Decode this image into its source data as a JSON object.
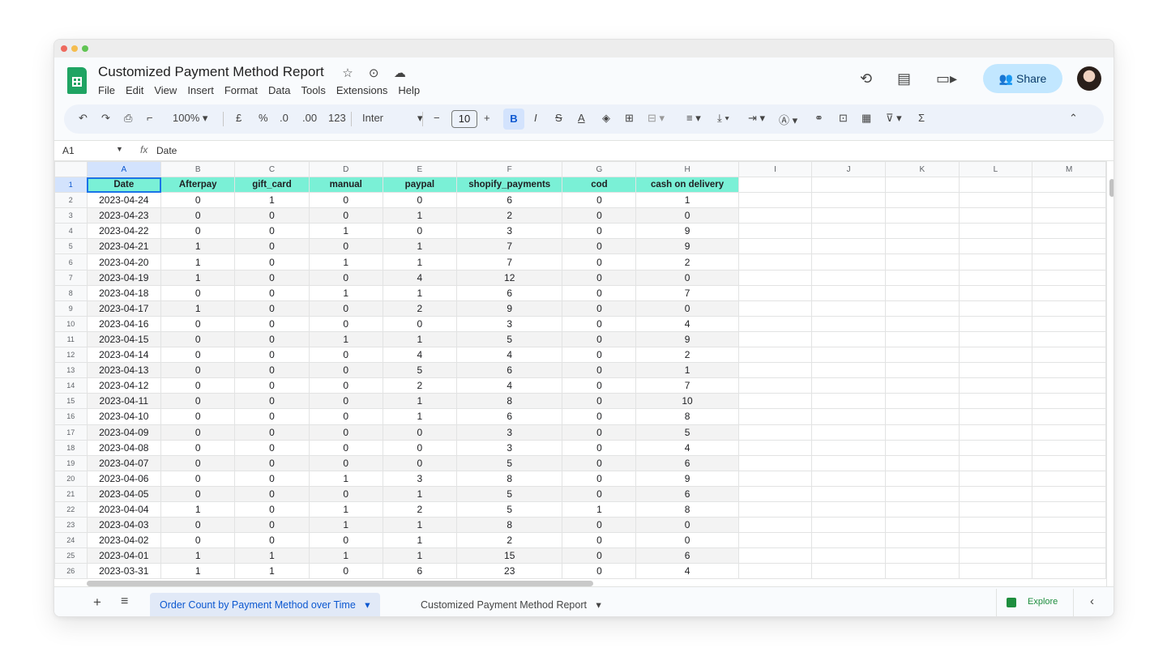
{
  "app": {
    "doc_title": "Customized Payment Method Report",
    "menu": [
      "File",
      "Edit",
      "View",
      "Insert",
      "Format",
      "Data",
      "Tools",
      "Extensions",
      "Help"
    ],
    "share_label": "Share"
  },
  "toolbar": {
    "zoom": "100%",
    "currency": "£",
    "percent": "%",
    "dec_decrease": ".0",
    "dec_increase": ".00",
    "number_format": "123",
    "font": "Inter",
    "font_size": "10",
    "bold": "B",
    "italic": "I",
    "strike": "S",
    "text_color": "A",
    "sum": "Σ"
  },
  "formula_bar": {
    "cell_ref": "A1",
    "fx": "fx",
    "value": "Date"
  },
  "columns": [
    "A",
    "B",
    "C",
    "D",
    "E",
    "F",
    "G",
    "H",
    "I",
    "J",
    "K",
    "L",
    "M"
  ],
  "headers": [
    "Date",
    "Afterpay",
    "gift_card",
    "manual",
    "paypal",
    "shopify_payments",
    "cod",
    "cash on delivery"
  ],
  "rows": [
    [
      "2023-04-24",
      "0",
      "1",
      "0",
      "0",
      "6",
      "0",
      "1"
    ],
    [
      "2023-04-23",
      "0",
      "0",
      "0",
      "1",
      "2",
      "0",
      "0"
    ],
    [
      "2023-04-22",
      "0",
      "0",
      "1",
      "0",
      "3",
      "0",
      "9"
    ],
    [
      "2023-04-21",
      "1",
      "0",
      "0",
      "1",
      "7",
      "0",
      "9"
    ],
    [
      "2023-04-20",
      "1",
      "0",
      "1",
      "1",
      "7",
      "0",
      "2"
    ],
    [
      "2023-04-19",
      "1",
      "0",
      "0",
      "4",
      "12",
      "0",
      "0"
    ],
    [
      "2023-04-18",
      "0",
      "0",
      "1",
      "1",
      "6",
      "0",
      "7"
    ],
    [
      "2023-04-17",
      "1",
      "0",
      "0",
      "2",
      "9",
      "0",
      "0"
    ],
    [
      "2023-04-16",
      "0",
      "0",
      "0",
      "0",
      "3",
      "0",
      "4"
    ],
    [
      "2023-04-15",
      "0",
      "0",
      "1",
      "1",
      "5",
      "0",
      "9"
    ],
    [
      "2023-04-14",
      "0",
      "0",
      "0",
      "4",
      "4",
      "0",
      "2"
    ],
    [
      "2023-04-13",
      "0",
      "0",
      "0",
      "5",
      "6",
      "0",
      "1"
    ],
    [
      "2023-04-12",
      "0",
      "0",
      "0",
      "2",
      "4",
      "0",
      "7"
    ],
    [
      "2023-04-11",
      "0",
      "0",
      "0",
      "1",
      "8",
      "0",
      "10"
    ],
    [
      "2023-04-10",
      "0",
      "0",
      "0",
      "1",
      "6",
      "0",
      "8"
    ],
    [
      "2023-04-09",
      "0",
      "0",
      "0",
      "0",
      "3",
      "0",
      "5"
    ],
    [
      "2023-04-08",
      "0",
      "0",
      "0",
      "0",
      "3",
      "0",
      "4"
    ],
    [
      "2023-04-07",
      "0",
      "0",
      "0",
      "0",
      "5",
      "0",
      "6"
    ],
    [
      "2023-04-06",
      "0",
      "0",
      "1",
      "3",
      "8",
      "0",
      "9"
    ],
    [
      "2023-04-05",
      "0",
      "0",
      "0",
      "1",
      "5",
      "0",
      "6"
    ],
    [
      "2023-04-04",
      "1",
      "0",
      "1",
      "2",
      "5",
      "1",
      "8"
    ],
    [
      "2023-04-03",
      "0",
      "0",
      "1",
      "1",
      "8",
      "0",
      "0"
    ],
    [
      "2023-04-02",
      "0",
      "0",
      "0",
      "1",
      "2",
      "0",
      "0"
    ],
    [
      "2023-04-01",
      "1",
      "1",
      "1",
      "1",
      "15",
      "0",
      "6"
    ],
    [
      "2023-03-31",
      "1",
      "1",
      "0",
      "6",
      "23",
      "0",
      "4"
    ]
  ],
  "tabs": {
    "add": "+",
    "menu": "≡",
    "active": "Order Count by Payment Method over Time",
    "inactive": "Customized Payment Method Report",
    "explore": "Explore"
  },
  "colors": {
    "header_fill": "#7af0d6",
    "share_bg": "#c2e7ff",
    "selection": "#1a73e8"
  }
}
